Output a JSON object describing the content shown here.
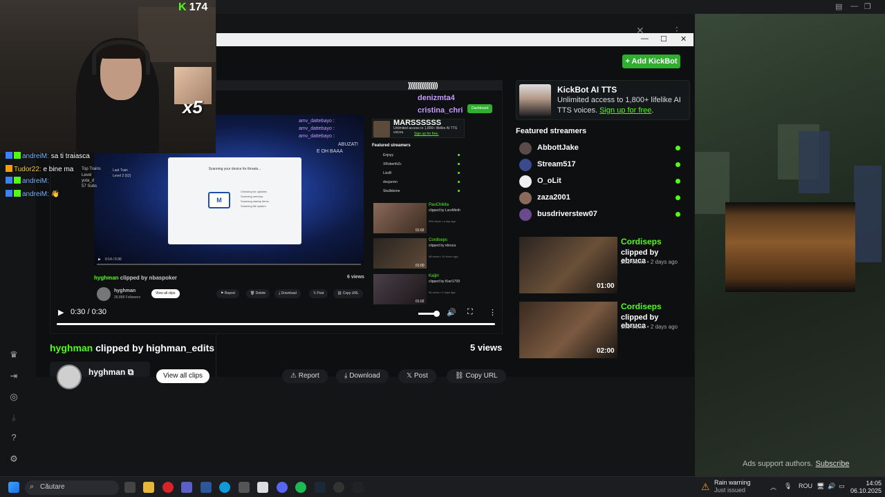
{
  "kick_counter": {
    "value": "174",
    "mark": "K"
  },
  "multiplier": "x5",
  "chat": [
    {
      "user": "andreiM:",
      "text": "sa ti traiasca",
      "user_color": "#7ab7ff"
    },
    {
      "user": "Tudor22:",
      "text": "e bine ma",
      "user_color": "#f7c948"
    },
    {
      "user": "andreiM:",
      "text": "",
      "user_color": "#7ab7ff"
    },
    {
      "user": "andreiM:",
      "text": "",
      "user_color": "#7ab7ff"
    }
  ],
  "main_window": {
    "add_kickbot_label": "+ Add KickBot",
    "window_controls": [
      "—",
      "☐",
      "✕"
    ]
  },
  "nested": {
    "overlay_lines": [
      {
        "user": "amv_dattebayo",
        "suffix": ":"
      },
      {
        "user": "amv_dattebayo",
        "suffix": ":"
      },
      {
        "user": "amv_dattebayo",
        "suffix": ":"
      }
    ],
    "overlay_extra": "ABUZAT!",
    "overlay_extra2": "E OH BAAA",
    "big_text": "))))))))))))))))",
    "name1": "denizmta4",
    "name2": "cristina_chri",
    "dashboard": "Dashboard",
    "promo_title": "MARSSSSSS",
    "promo_desc": "Unlimited access to 1,800+ lifelike AI TTS voices.",
    "promo_link": "Sign up for free.",
    "featured_title": "Featured streamers",
    "streamers": [
      "Enjoyy",
      "XRoberthZc",
      "LizzB",
      "docjarren",
      "Skullsbone"
    ],
    "clips": [
      {
        "name": "PauChikita",
        "by": "clipped by LarsMinth",
        "meta": "309 views • a day ago",
        "dur": "01:02"
      },
      {
        "name": "Cordiseps",
        "by": "clipped by ebruca",
        "meta": "98 views • 19 hours ago",
        "dur": "01:00"
      },
      {
        "name": "Kaijiri",
        "by": "clipped by Kiari1709",
        "meta": "96 views • 2 days ago",
        "dur": "01:02"
      }
    ],
    "top_trains": "Top Trains",
    "last_train": "Last Train",
    "level": "Level",
    "level2": "Level 2 (52)",
    "user_subs": "yuta_d",
    "subs": "57 Subs",
    "dialog_title": "Scanning your device for threats...",
    "dialog_items": [
      "Checking for updates",
      "Scanning memory",
      "Scanning startup items",
      "Scanning file system"
    ],
    "inner_time": "0:14 / 0:30",
    "inner_clip_title_user": "hyghman",
    "inner_clip_title_rest": "clipped by nbaspoker",
    "inner_views": "6 views",
    "inner_channel": "hyghman",
    "inner_followers": "28,868 Followers",
    "inner_view_all": "View all clips",
    "inner_buttons": [
      "Report",
      "Delete",
      "Download",
      "Post",
      "Copy URL"
    ]
  },
  "player": {
    "time": "0:30 / 0:30",
    "progress": 1.0,
    "volume": 0.8
  },
  "clip": {
    "user": "hyghman",
    "rest": "clipped by highman_edits",
    "views": "5 views",
    "channel": "hyghman",
    "view_all": "View all clips",
    "buttons": [
      "Report",
      "Download",
      "Post",
      "Copy URL"
    ]
  },
  "promo": {
    "title": "KickBot AI TTS",
    "desc": "Unlimited access to 1,800+ lifelike AI TTS voices.",
    "link": "Sign up for free"
  },
  "featured": {
    "title": "Featured streamers",
    "streamers": [
      {
        "name": "AbbottJake"
      },
      {
        "name": "Stream517"
      },
      {
        "name": "O_oLit"
      },
      {
        "name": "zaza2001"
      },
      {
        "name": "busdriverstew07"
      }
    ]
  },
  "right_clips": [
    {
      "name": "Cordiseps",
      "by": "clipped by ebruca",
      "meta": "251 views • 2 days ago",
      "dur": "01:00"
    },
    {
      "name": "Cordiseps",
      "by": "clipped by ebruca",
      "meta": "169 views • 2 days ago",
      "dur": "02:00"
    }
  ],
  "ads": {
    "text": "Ads support authors.",
    "link": "Subscribe"
  },
  "taskbar": {
    "search_placeholder": "Căutare",
    "weather_title": "Rain warning",
    "weather_sub": "Just issued",
    "lang": "ROU",
    "time": "14:05",
    "date": "06.10.2025"
  },
  "colors": {
    "kick_green": "#53fc18",
    "accent_button": "#2fae2f"
  }
}
